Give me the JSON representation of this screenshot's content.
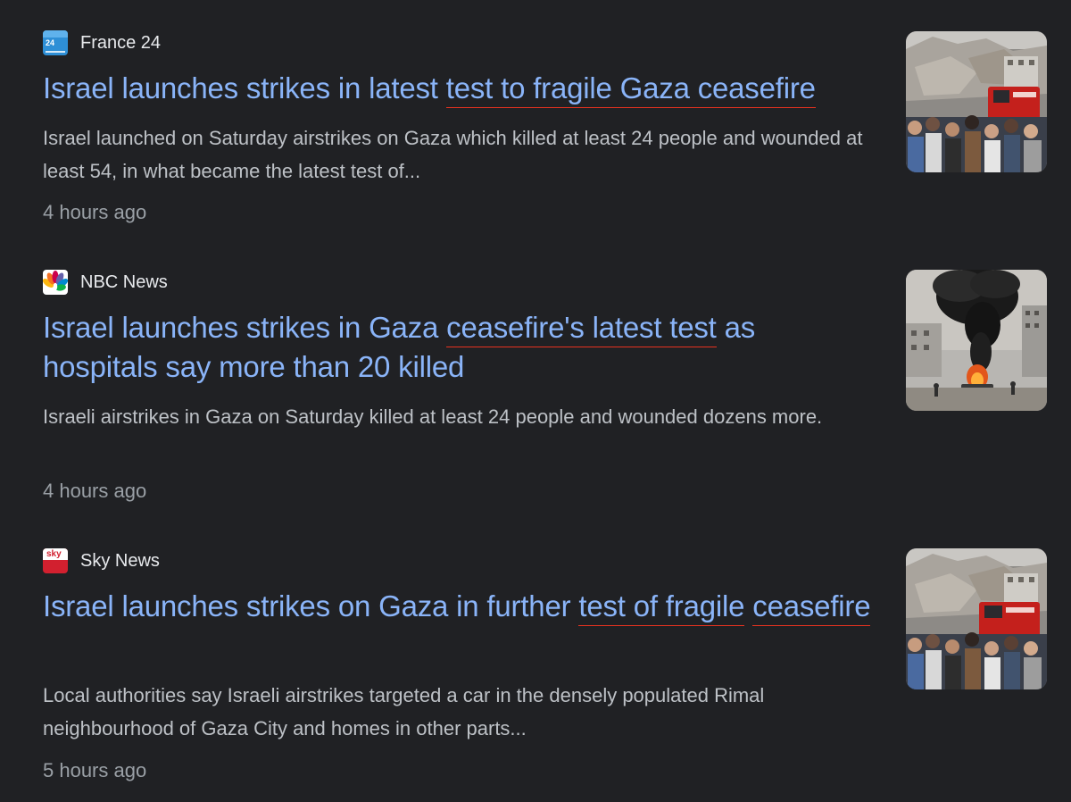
{
  "results": [
    {
      "source": "France 24",
      "favicon_icon": "france24-icon",
      "favicon_text": "24",
      "headline_parts": [
        {
          "text": "Israel launches strikes in latest ",
          "highlight": false
        },
        {
          "text": "test to fragile Gaza ceasefire",
          "highlight": true
        }
      ],
      "snippet": "Israel launched on Saturday airstrikes on Gaza which killed at least 24 people and wounded at least 54, in what became the latest test of...",
      "time": "4 hours ago",
      "thumbnail_icon": "rubble-crowd-photo"
    },
    {
      "source": "NBC News",
      "favicon_icon": "nbc-peacock-icon",
      "headline_parts": [
        {
          "text": "Israel launches strikes in Gaza ",
          "highlight": false
        },
        {
          "text": "ceasefire's latest test",
          "highlight": true
        },
        {
          "text": " as hospitals say more than 20 killed",
          "highlight": false
        }
      ],
      "snippet": "Israeli airstrikes in Gaza on Saturday killed at least 24 people and wounded dozens more.",
      "time": "4 hours ago",
      "thumbnail_icon": "burning-vehicle-smoke-photo"
    },
    {
      "source": "Sky News",
      "favicon_icon": "sky-news-icon",
      "favicon_text": "sky",
      "headline_parts": [
        {
          "text": "Israel launches strikes on Gaza in further ",
          "highlight": false
        },
        {
          "text": "test of fragile",
          "highlight": true
        },
        {
          "text": " ",
          "highlight": false
        },
        {
          "text": "ceasefire",
          "highlight": true
        }
      ],
      "snippet": "Local authorities say Israeli airstrikes targeted a car in the densely populated Rimal neighbourhood of Gaza City and homes in other parts...",
      "time": "5 hours ago",
      "thumbnail_icon": "rubble-crowd-photo"
    }
  ],
  "colors": {
    "background": "#202124",
    "headline": "#8ab4f8",
    "highlight_underline": "#e8321f",
    "source_text": "#e8eaed",
    "snippet_text": "#bdc1c6",
    "time_text": "#9aa0a6"
  }
}
